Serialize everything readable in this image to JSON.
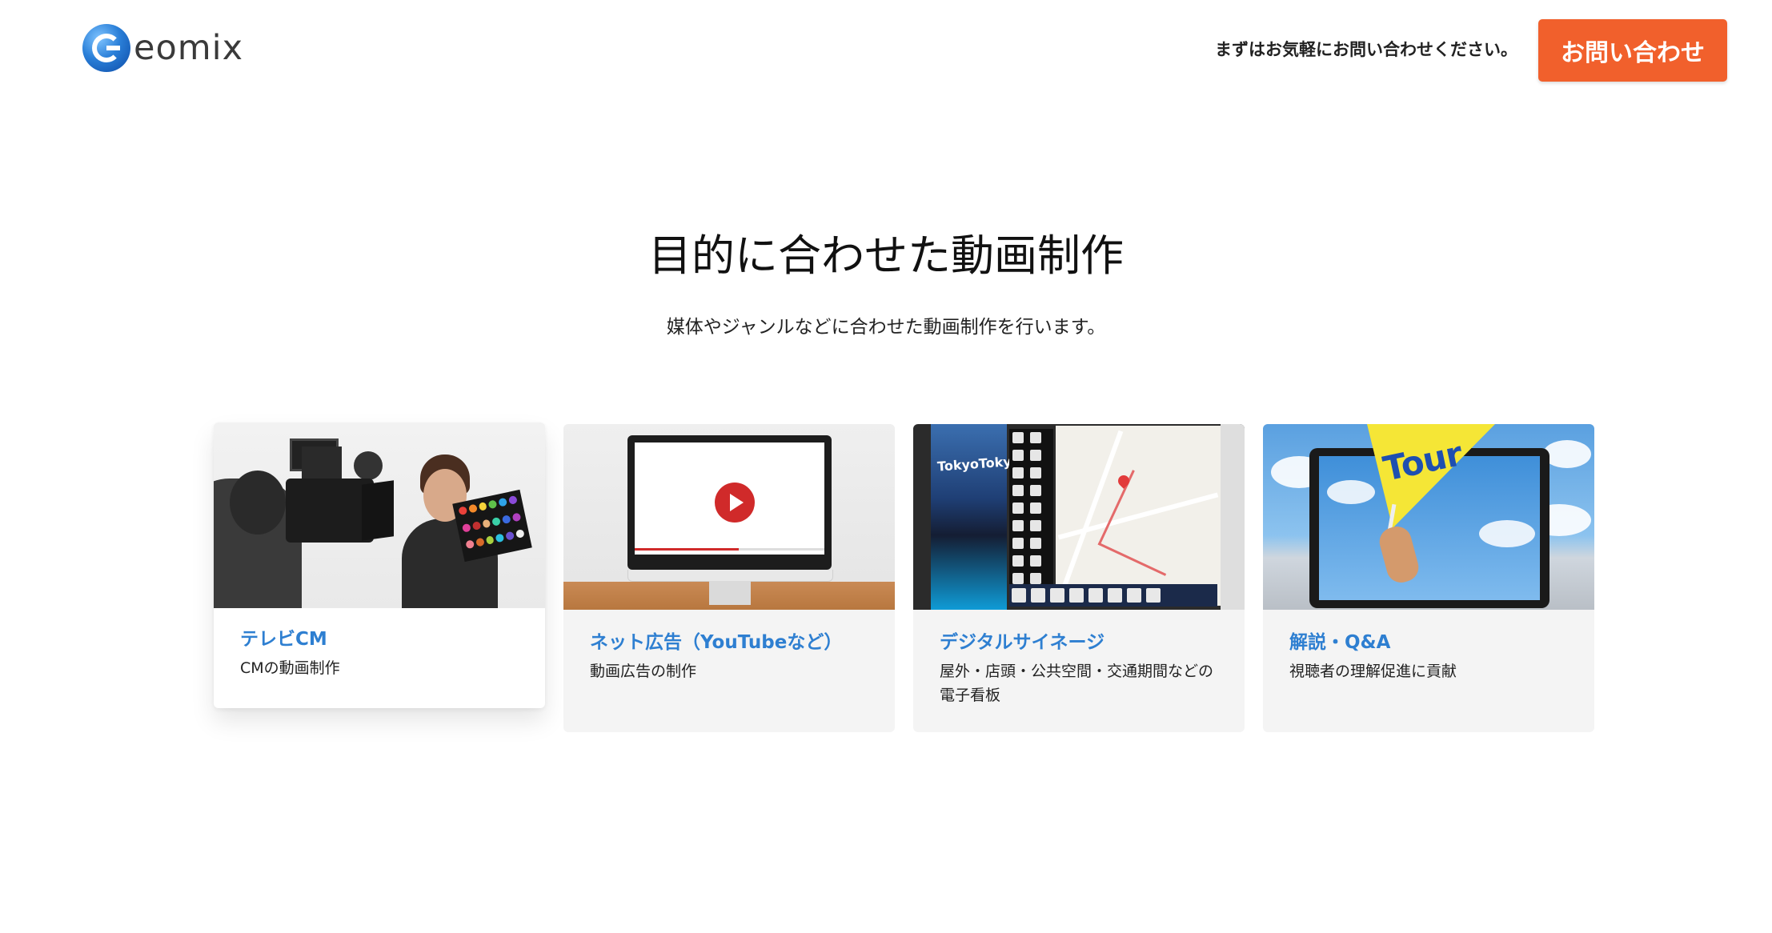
{
  "header": {
    "logo_text": "eomix",
    "note": "まずはお気軽にお問い合わせください。",
    "contact_label": "お問い合わせ",
    "accent_color": "#f1602c"
  },
  "section": {
    "title": "目的に合わせた動画制作",
    "lead": "媒体やジャンルなどに合わせた動画制作を行います。"
  },
  "cards": [
    {
      "title": "テレビCM",
      "desc": "CMの動画制作",
      "state": "hover"
    },
    {
      "title": "ネット広告（YouTubeなど）",
      "desc": "動画広告の制作"
    },
    {
      "title": "デジタルサイネージ",
      "desc": "屋外・店頭・公共空間・交通期間などの電子看板",
      "image_text": "TokyoTokyo"
    },
    {
      "title": "解説・Q&A",
      "desc": "視聴者の理解促進に貢献",
      "image_text": "Tour"
    }
  ],
  "colors": {
    "card_title": "#2e7fd1",
    "card_bg": "#f4f4f4",
    "play_button": "#d02a2a",
    "flag": "#f5e636"
  }
}
